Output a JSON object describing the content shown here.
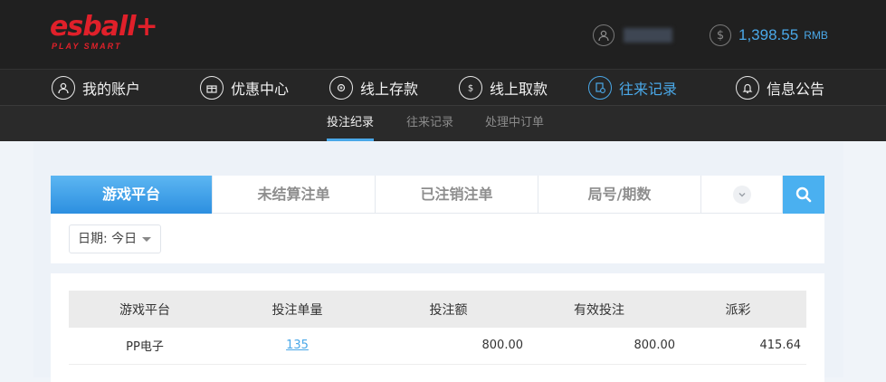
{
  "header": {
    "logo_main": "esball+",
    "logo_sub": "PLAY SMART",
    "username": "",
    "balance": "1,398.55",
    "currency": "RMB"
  },
  "nav": {
    "items": [
      {
        "label": "我的账户",
        "icon": "user-icon"
      },
      {
        "label": "优惠中心",
        "icon": "gift-icon"
      },
      {
        "label": "线上存款",
        "icon": "deposit-icon"
      },
      {
        "label": "线上取款",
        "icon": "withdraw-icon"
      },
      {
        "label": "往来记录",
        "icon": "records-icon",
        "active": true
      },
      {
        "label": "信息公告",
        "icon": "bell-icon"
      }
    ]
  },
  "subnav": {
    "items": [
      {
        "label": "投注纪录",
        "active": true
      },
      {
        "label": "往来记录"
      },
      {
        "label": "处理中订单"
      }
    ]
  },
  "filter": {
    "tabs": [
      {
        "label": "游戏平台",
        "active": true
      },
      {
        "label": "未结算注单"
      },
      {
        "label": "已注销注单"
      },
      {
        "label": "局号/期数"
      }
    ],
    "date_label": "日期: 今日"
  },
  "table": {
    "columns": [
      "游戏平台",
      "投注单量",
      "投注额",
      "有效投注",
      "派彩"
    ],
    "rows": [
      {
        "platform": "PP电子",
        "count": "135",
        "amount": "800.00",
        "valid": "800.00",
        "payout": "415.64"
      }
    ]
  },
  "colors": {
    "accent": "#4aa8e8",
    "brand": "#e0202a",
    "header_bg": "#202020"
  }
}
